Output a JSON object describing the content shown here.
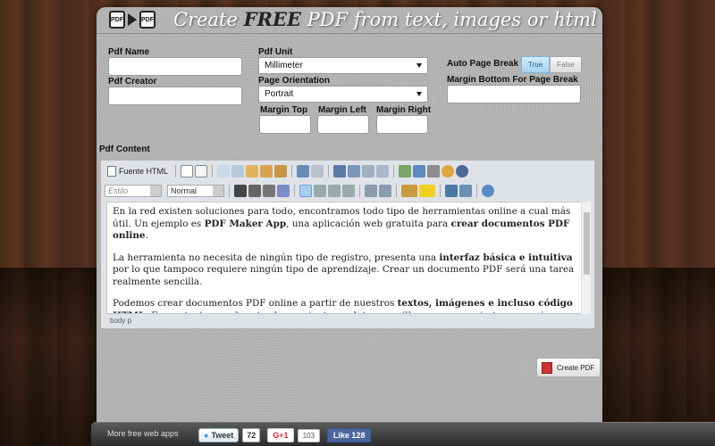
{
  "header": {
    "title_pre": "Create ",
    "title_bold": "FREE",
    "title_post": " PDF from text, images or html",
    "logo_left": "PDF",
    "logo_right": "PDF"
  },
  "form": {
    "pdf_name_label": "Pdf Name",
    "pdf_creator_label": "Pdf Creator",
    "pdf_unit_label": "Pdf Unit",
    "pdf_unit_value": "Millimeter",
    "orientation_label": "Page Orientation",
    "orientation_value": "Portrait",
    "margin_top_label": "Margin Top",
    "margin_left_label": "Margin Left",
    "margin_right_label": "Margin Right",
    "auto_break_label": "Auto Page Break",
    "auto_break_true": "True",
    "auto_break_false": "False",
    "margin_bottom_label": "Margin Bottom For Page Break",
    "content_label": "Pdf Content"
  },
  "editor": {
    "source_button": "Fuente HTML",
    "style_combo": "Estilo",
    "format_combo": "Normal",
    "path": "body  p",
    "paragraphs": [
      [
        {
          "t": "En la red existen soluciones para todo, encontramos todo tipo de herramientas online a cual más útil. Un ejemplo es ",
          "b": false
        },
        {
          "t": "PDF Maker App",
          "b": true
        },
        {
          "t": ", una aplicación web gratuita para ",
          "b": false
        },
        {
          "t": "crear documentos PDF online",
          "b": true
        },
        {
          "t": ".",
          "b": false
        }
      ],
      [
        {
          "t": "La herramienta no necesita de ningún tipo de registro, presenta una ",
          "b": false
        },
        {
          "t": "interfaz básica e intuitiva",
          "b": true
        },
        {
          "t": " por lo que tampoco requiere ningún tipo de aprendizaje. Crear un documento PDF será una tarea realmente sencilla.",
          "b": false
        }
      ],
      [
        {
          "t": "Podemos crear documentos PDF online a partir de nuestros ",
          "b": false
        },
        {
          "t": "textos, imágenes e incluso código HTML",
          "b": true
        },
        {
          "t": ". Es por tanto una de estas herramientas web tan sencillas que se convierten en casi imprescindibles.",
          "b": false
        }
      ]
    ]
  },
  "actions": {
    "create_pdf": "Create PDF"
  },
  "footer": {
    "more_apps": "More free web apps",
    "tweet_label": "Tweet",
    "tweet_count": "72",
    "gplus_label": "G+1",
    "gplus_count": "103",
    "like_label": "Like 128"
  },
  "colors": {
    "panel": "#b3b3b3",
    "toggle_active": "#a7d3f2",
    "facebook": "#4a66a0"
  }
}
